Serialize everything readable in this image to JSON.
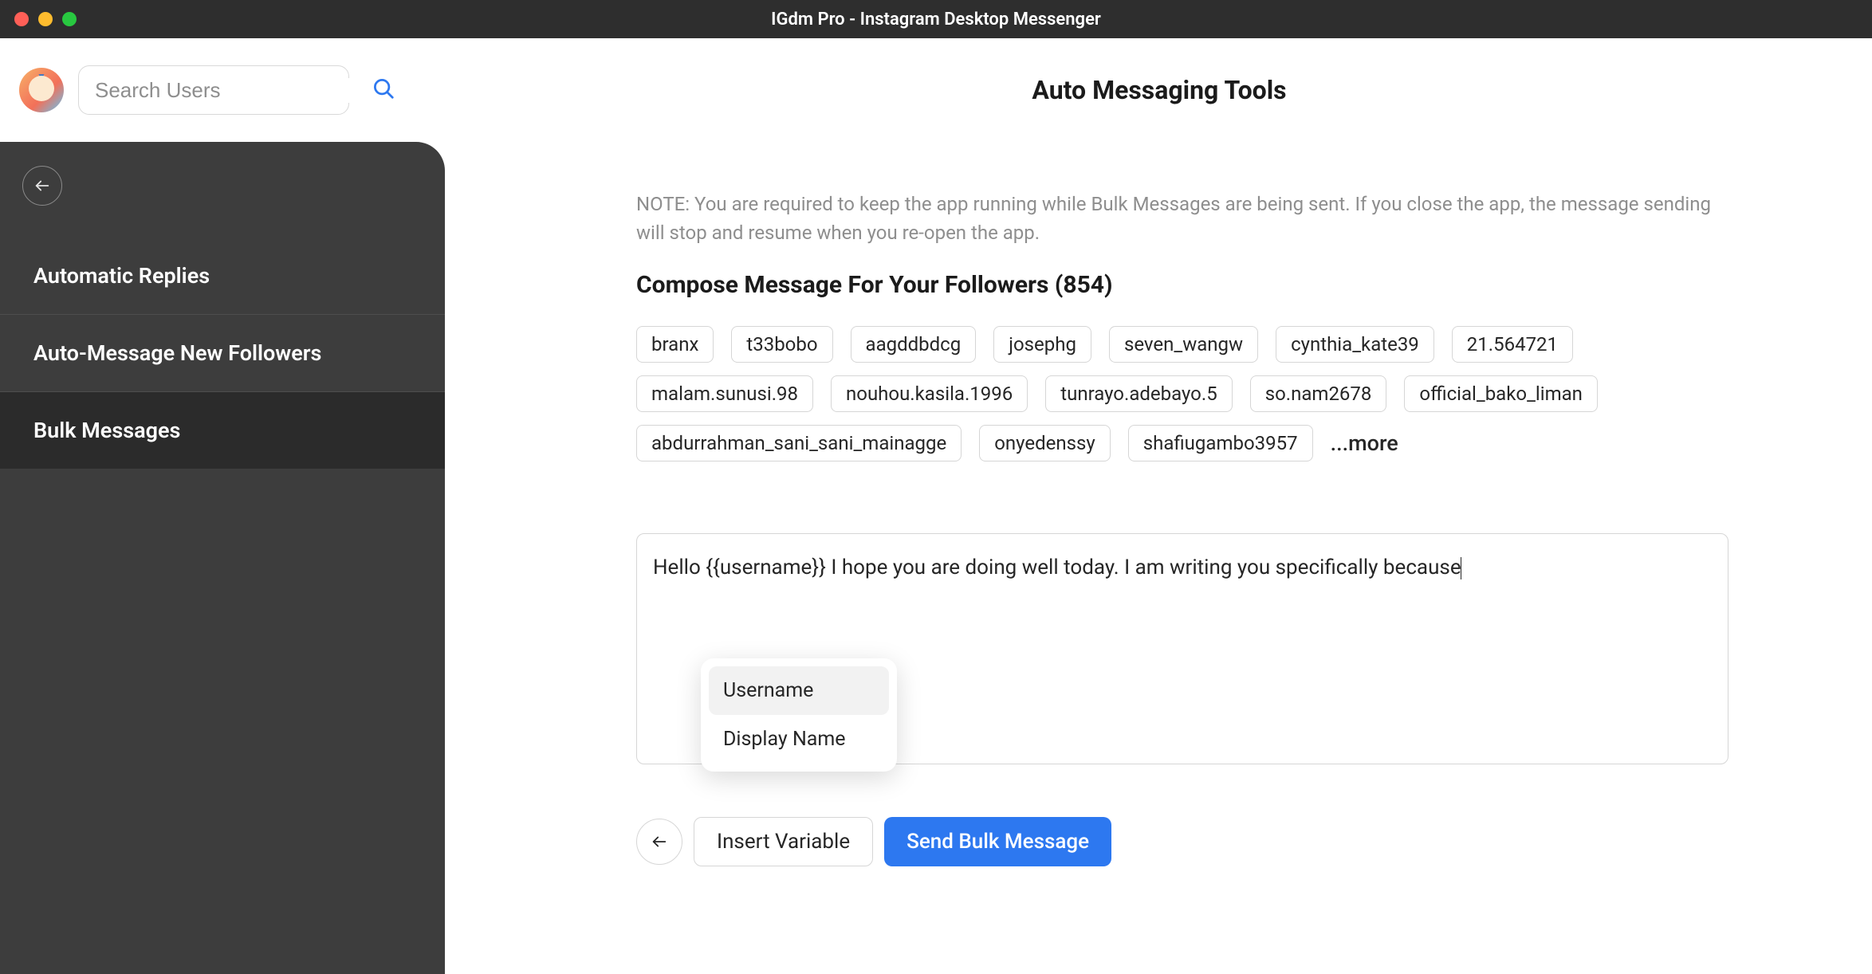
{
  "window": {
    "title": "IGdm Pro - Instagram Desktop Messenger"
  },
  "search": {
    "placeholder": "Search Users"
  },
  "header": {
    "page_title": "Auto Messaging Tools"
  },
  "sidebar": {
    "items": [
      {
        "label": "Automatic Replies",
        "active": false
      },
      {
        "label": "Auto-Message New Followers",
        "active": false
      },
      {
        "label": "Bulk Messages",
        "active": true
      }
    ]
  },
  "main": {
    "note": "NOTE: You are required to keep the app running while Bulk Messages are being sent. If you close the app, the message sending will stop and resume when you re-open the app.",
    "compose_heading": "Compose Message For Your Followers (854)",
    "followers_count": 854,
    "chips": [
      "branx",
      "t33bobo",
      "aagddbdcg",
      "josephg",
      "seven_wangw",
      "cynthia_kate39",
      "21.564721",
      "malam.sunusi.98",
      "nouhou.kasila.1996",
      "tunrayo.adebayo.5",
      "so.nam2678",
      "official_bako_liman",
      "abdurrahman_sani_sani_mainagge",
      "onyedenssy",
      "shafiugambo3957"
    ],
    "more_label": "...more",
    "message_text": "Hello  {{username}} I hope you are doing well today. I am writing you specifically because",
    "variable_popup": {
      "items": [
        {
          "label": "Username",
          "hover": true
        },
        {
          "label": "Display Name",
          "hover": false
        }
      ]
    },
    "buttons": {
      "insert_variable": "Insert Variable",
      "send_bulk": "Send Bulk Message"
    }
  }
}
